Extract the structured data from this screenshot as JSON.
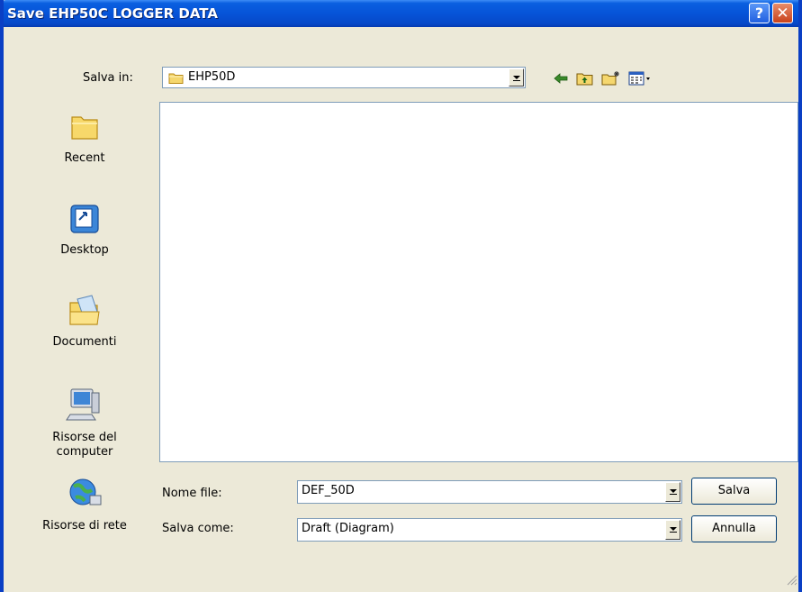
{
  "window": {
    "title": "Save EHP50C LOGGER DATA"
  },
  "title_buttons": {
    "help": "?",
    "close": "✕"
  },
  "toolbar": {
    "save_in_label": "Salva in:",
    "save_in_value": "EHP50D",
    "icons": [
      "back-icon",
      "up-folder-icon",
      "new-folder-icon",
      "view-menu-icon"
    ]
  },
  "places": [
    {
      "label": "Recent",
      "icon": "recent-folder-icon"
    },
    {
      "label": "Desktop",
      "icon": "desktop-icon"
    },
    {
      "label": "Documenti",
      "icon": "documents-icon"
    },
    {
      "label": "Risorse del computer",
      "icon": "my-computer-icon"
    },
    {
      "label": "Risorse di rete",
      "icon": "network-places-icon"
    }
  ],
  "file_name": {
    "label": "Nome file:",
    "value": "DEF_50D"
  },
  "save_as": {
    "label": "Salva come:",
    "value": "Draft (Diagram)"
  },
  "buttons": {
    "save": "Salva",
    "cancel": "Annulla"
  }
}
